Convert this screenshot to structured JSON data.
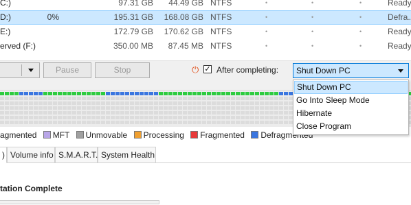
{
  "disks": [
    {
      "name": "C:)",
      "frag": "",
      "capacity": "97.31 GB",
      "free": "44.49 GB",
      "fs": "NTFS",
      "dots": [
        "•",
        "•",
        "•"
      ],
      "status": "Ready",
      "selected": false
    },
    {
      "name": "D:)",
      "frag": "0%",
      "capacity": "195.31 GB",
      "free": "168.08 GB",
      "fs": "NTFS",
      "dots": [
        "•",
        "•",
        "•"
      ],
      "status": "Defra...",
      "selected": true
    },
    {
      "name": "E:)",
      "frag": "",
      "capacity": "172.79 GB",
      "free": "170.62 GB",
      "fs": "NTFS",
      "dots": [
        "•",
        "•",
        "•"
      ],
      "status": "Ready",
      "selected": false
    },
    {
      "name": "erved (F:)",
      "frag": "",
      "capacity": "350.00 MB",
      "free": "87.45 MB",
      "fs": "NTFS",
      "dots": [
        "•",
        "•",
        "•"
      ],
      "status": "Ready",
      "selected": false
    }
  ],
  "toolbar": {
    "pause_label": "Pause",
    "stop_label": "Stop",
    "after_label": "After completing:",
    "after_checked": true,
    "after_selected": "Shut Down PC"
  },
  "dropdown_options": [
    {
      "label": "Shut Down PC",
      "highlighted": true
    },
    {
      "label": "Go Into Sleep Mode",
      "highlighted": false
    },
    {
      "label": "Hibernate",
      "highlighted": false
    },
    {
      "label": "Close Program",
      "highlighted": false
    }
  ],
  "legend": [
    {
      "label": "agmented",
      "color": ""
    },
    {
      "label": "MFT",
      "color": "#b9a6e8"
    },
    {
      "label": "Unmovable",
      "color": "#a0a0a0"
    },
    {
      "label": "Processing",
      "color": "#f0a030"
    },
    {
      "label": "Fragmented",
      "color": "#e83a3a"
    },
    {
      "label": "Defragmented",
      "color": "#3a76e0"
    }
  ],
  "tabs": [
    ")",
    "Volume info",
    "S.M.A.R.T.",
    "System Health"
  ],
  "status_heading": "tation Complete",
  "colors": {
    "selection": "#cce8ff",
    "power_icon": "#e2521d",
    "used_block": "#2ecc40",
    "defrag_block": "#3a76e0"
  }
}
